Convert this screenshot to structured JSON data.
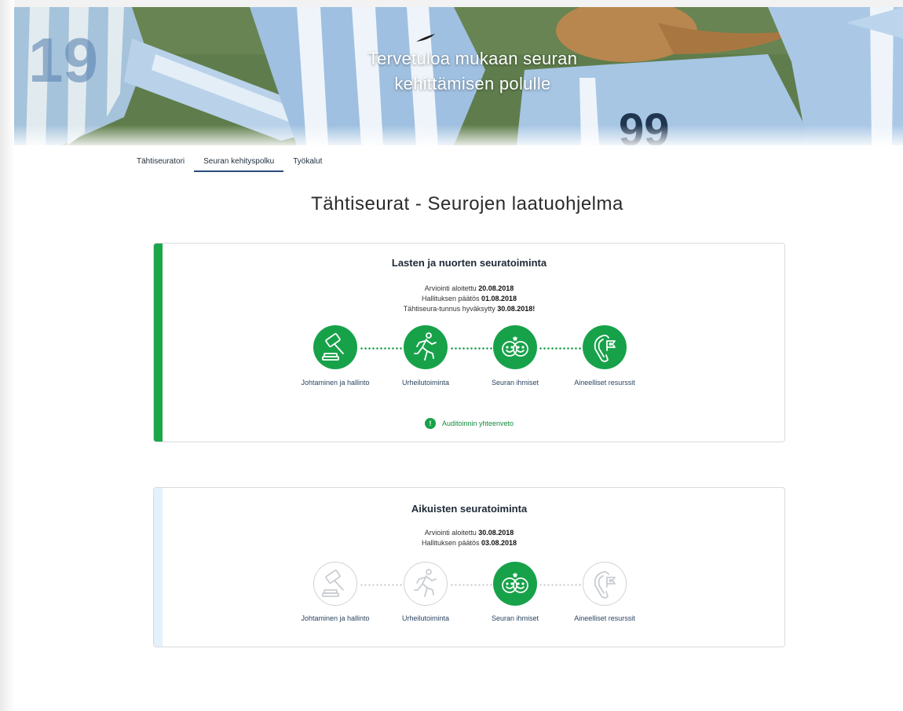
{
  "hero": {
    "title_line1": "Tervetuloa mukaan seuran",
    "title_line2": "kehittämisen polulle"
  },
  "tabs": [
    {
      "label": "Tähtiseuratori"
    },
    {
      "label": "Seuran kehityspolku",
      "active": true
    },
    {
      "label": "Työkalut"
    }
  ],
  "page_title": "Tähtiseurat - Seurojen laatuohjelma",
  "colors": {
    "accent": "#17a24a",
    "inactive_circle_border": "#cfd3d7",
    "card1_stripe": "#1ca64a",
    "card2_stripe": "#e3f1fb",
    "tab_underline": "#2a4a7a"
  },
  "cards": [
    {
      "title": "Lasten ja nuorten seuratoiminta",
      "meta": [
        {
          "label": "Arviointi aloitettu ",
          "value": "20.08.2018"
        },
        {
          "label": "Hallituksen päätös ",
          "value": "01.08.2018"
        },
        {
          "label": "Tähtiseura-tunnus hyväksytty ",
          "value": "30.08.2018!"
        }
      ],
      "steps": [
        {
          "label": "Johtaminen ja hallinto",
          "icon": "gavel-icon",
          "active": true
        },
        {
          "label": "Urheilutoiminta",
          "icon": "runner-icon",
          "active": true
        },
        {
          "label": "Seuran ihmiset",
          "icon": "smileys-icon",
          "active": true
        },
        {
          "label": "Aineelliset resurssit",
          "icon": "carabiner-flag-icon",
          "active": true
        }
      ],
      "summary_label": "Auditoinnin yhteenveto",
      "summary_icon": "!"
    },
    {
      "title": "Aikuisten seuratoiminta",
      "meta": [
        {
          "label": "Arviointi aloitettu ",
          "value": "30.08.2018"
        },
        {
          "label": "Hallituksen päätös ",
          "value": "03.08.2018"
        }
      ],
      "steps": [
        {
          "label": "Johtaminen ja hallinto",
          "icon": "gavel-icon",
          "active": false
        },
        {
          "label": "Urheilutoiminta",
          "icon": "runner-icon",
          "active": false
        },
        {
          "label": "Seuran ihmiset",
          "icon": "smileys-icon",
          "active": true
        },
        {
          "label": "Aineelliset resurssit",
          "icon": "carabiner-flag-icon",
          "active": false
        }
      ]
    }
  ]
}
